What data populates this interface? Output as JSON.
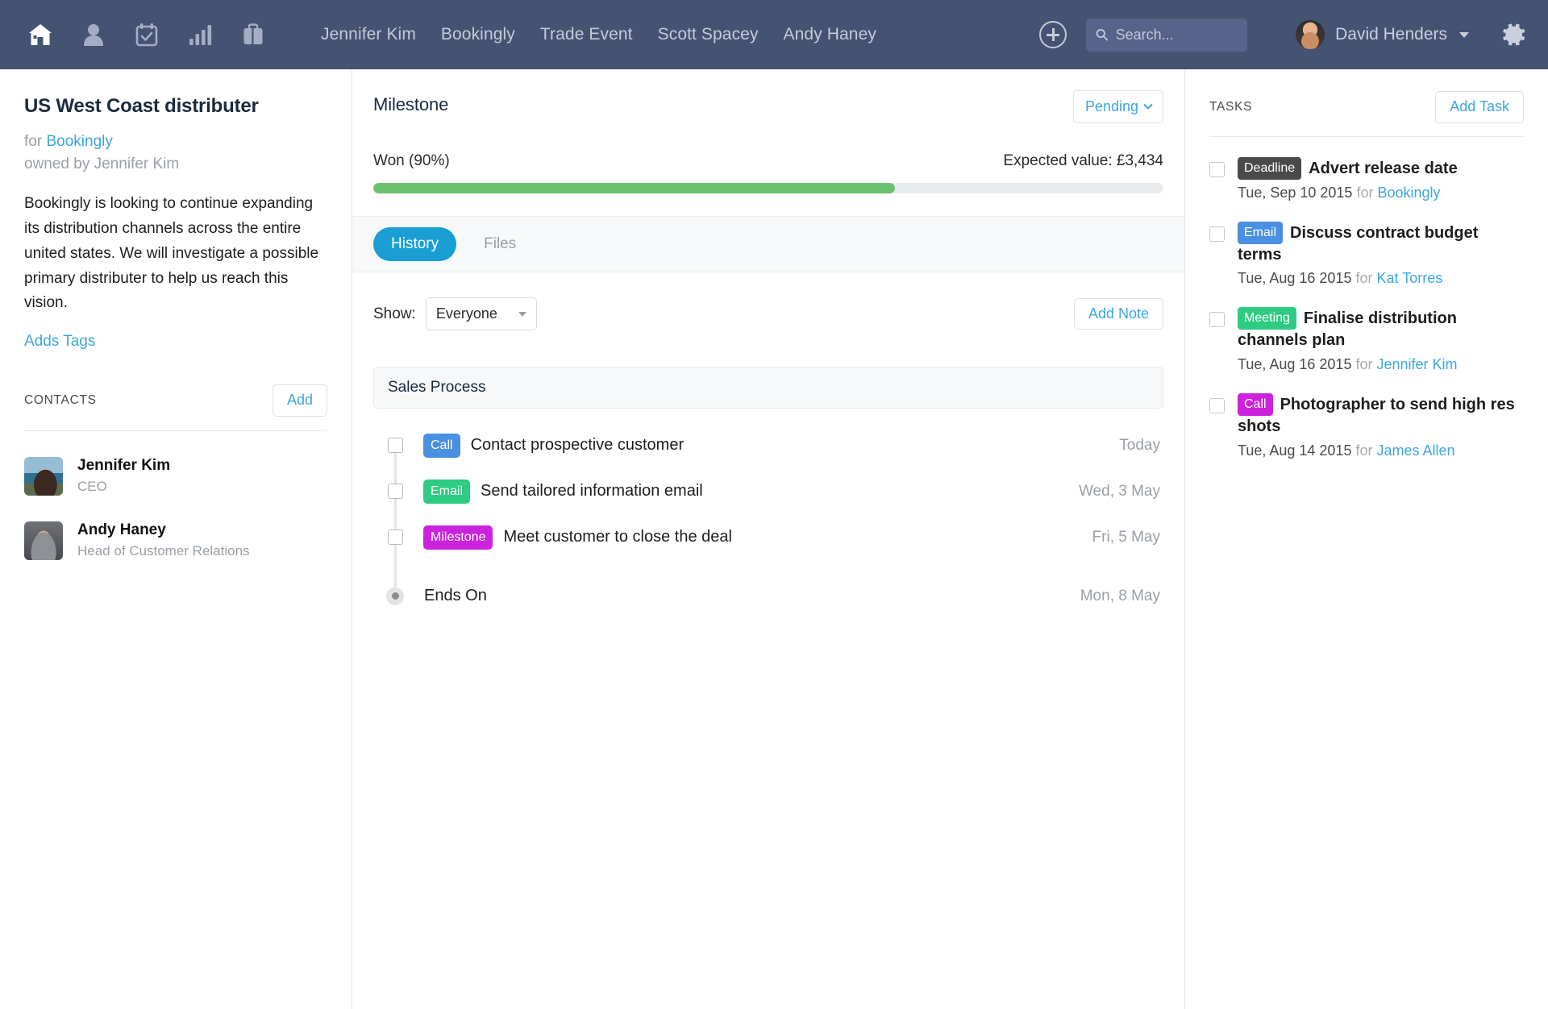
{
  "nav": {
    "icons": [
      {
        "name": "home-icon",
        "label": "Home",
        "active": true
      },
      {
        "name": "contacts-icon",
        "label": "Contacts",
        "active": false
      },
      {
        "name": "calendar-check-icon",
        "label": "Calendar",
        "active": false
      },
      {
        "name": "bar-chart-icon",
        "label": "Reports",
        "active": false
      },
      {
        "name": "briefcase-icon",
        "label": "Deals",
        "active": false
      }
    ],
    "links": [
      "Jennifer Kim",
      "Bookingly",
      "Trade Event",
      "Scott Spacey",
      "Andy Haney"
    ],
    "add_icon": "plus-circle-icon",
    "gear_icon": "gear-icon",
    "search": {
      "placeholder": "Search...",
      "value": "",
      "icon": "search-icon"
    },
    "user": {
      "name": "David Henders",
      "avatar": "user-avatar",
      "caret": "chevron-down-icon"
    },
    "bg_color": "#455372"
  },
  "sidebar": {
    "title": "US West Coast distributer",
    "for_label": "for",
    "company": "Bookingly",
    "owner_line": "owned by Jennifer Kim",
    "description": "Bookingly is looking to continue expanding its distribution channels across the entire united states. We will investigate a possible primary distributer to help us reach this vision.",
    "tags_link": "Adds Tags",
    "contacts_label": "CONTACTS",
    "add_label": "Add",
    "contacts": [
      {
        "name": "Jennifer Kim",
        "role": "CEO"
      },
      {
        "name": "Andy Haney",
        "role": "Head of Customer Relations"
      }
    ]
  },
  "main": {
    "title": "Milestone",
    "status": "Pending",
    "won_label": "Won (90%)",
    "expected_value": "Expected value: £3,434",
    "progress_percent": 66,
    "tabs": [
      {
        "label": "History",
        "active": true
      },
      {
        "label": "Files",
        "active": false
      }
    ],
    "show_label": "Show:",
    "show_value": "Everyone",
    "add_note_label": "Add Note",
    "sales_process_label": "Sales Process",
    "timeline": [
      {
        "badge": "Call",
        "badge_color": "#4a90e2",
        "text": "Contact prospective customer",
        "date": "Today",
        "type": "check"
      },
      {
        "badge": "Email",
        "badge_color": "#2ecc83",
        "text": "Send tailored information email",
        "date": "Wed, 3 May",
        "type": "check"
      },
      {
        "badge": "Milestone",
        "badge_color": "#cc22dd",
        "text": "Meet customer to close the deal",
        "date": "Fri, 5 May",
        "type": "check"
      },
      {
        "badge": "",
        "badge_color": "",
        "text": "Ends On",
        "date": "Mon, 8 May",
        "type": "dot"
      }
    ]
  },
  "tasks": {
    "label": "TASKS",
    "add_label": "Add Task",
    "items": [
      {
        "badge": "Deadline",
        "badge_color": "#4a4a4a",
        "title": "Advert release date",
        "date": "Tue, Sep 10 2015",
        "for_label": "for",
        "person": "Bookingly"
      },
      {
        "badge": "Email",
        "badge_color": "#4a90e2",
        "title": "Discuss contract budget terms",
        "date": "Tue, Aug 16 2015",
        "for_label": "for",
        "person": "Kat Torres"
      },
      {
        "badge": "Meeting",
        "badge_color": "#2ecc83",
        "title": "Finalise distribution channels plan",
        "date": "Tue, Aug 16 2015",
        "for_label": "for",
        "person": "Jennifer Kim"
      },
      {
        "badge": "Call",
        "badge_color": "#cc22dd",
        "title": "Photographer to send high res shots",
        "date": "Tue, Aug 14 2015",
        "for_label": "for",
        "person": "James Allen"
      }
    ]
  },
  "colors": {
    "nav_bg": "#455372",
    "accent_blue": "#3ba7dd",
    "tab_active": "#1a9ed4",
    "progress_green": "#6bc071"
  }
}
